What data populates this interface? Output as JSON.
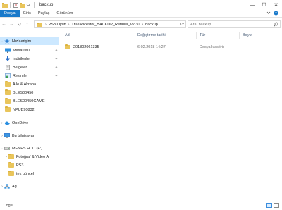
{
  "window": {
    "title": "backup",
    "controls": {
      "minimize": "—",
      "maximize": "☐",
      "close": "✕"
    }
  },
  "ribbon": {
    "tabs": [
      "Dosya",
      "Giriş",
      "Paylaş",
      "Görünüm"
    ],
    "expand_icon": "chevron-down-icon",
    "help_icon": "help-icon"
  },
  "address": {
    "back": "←",
    "forward": "→",
    "up": "↑",
    "segments": [
      "PS3 Oyun",
      "TrueAncestor_BACKUP_Retailer_v2.30",
      "backup"
    ]
  },
  "search": {
    "placeholder": "Ara: backup"
  },
  "navigation": {
    "quick_access": "Hızlı erişim",
    "pinned": [
      "Masaüstü",
      "İndirilenler",
      "Belgeler",
      "Resimler"
    ],
    "folders": [
      "Aile & Akraba",
      "BLES00450",
      "BLES00450GAME",
      "NPUB90832"
    ],
    "onedrive": "OneDrive",
    "this_pc": "Bu bilgisayar",
    "drive": "MENES HDD (F:)",
    "drive_children": [
      "Fotoğraf & Video A",
      "PS3",
      "tek güncel"
    ],
    "network": "Ağ"
  },
  "list": {
    "columns": {
      "name": "Ad",
      "date": "Değiştirme tarihi",
      "type": "Tür",
      "size": "Boyut"
    },
    "rows": [
      {
        "name": "201802061335",
        "date": "6.02.2018 14:27",
        "type": "Dosya klasörü",
        "size": ""
      }
    ]
  },
  "status": {
    "items": "1 öğe"
  },
  "colors": {
    "accent": "#1979ca",
    "folder": "#e9c55b",
    "selected": "#cce8ff"
  }
}
